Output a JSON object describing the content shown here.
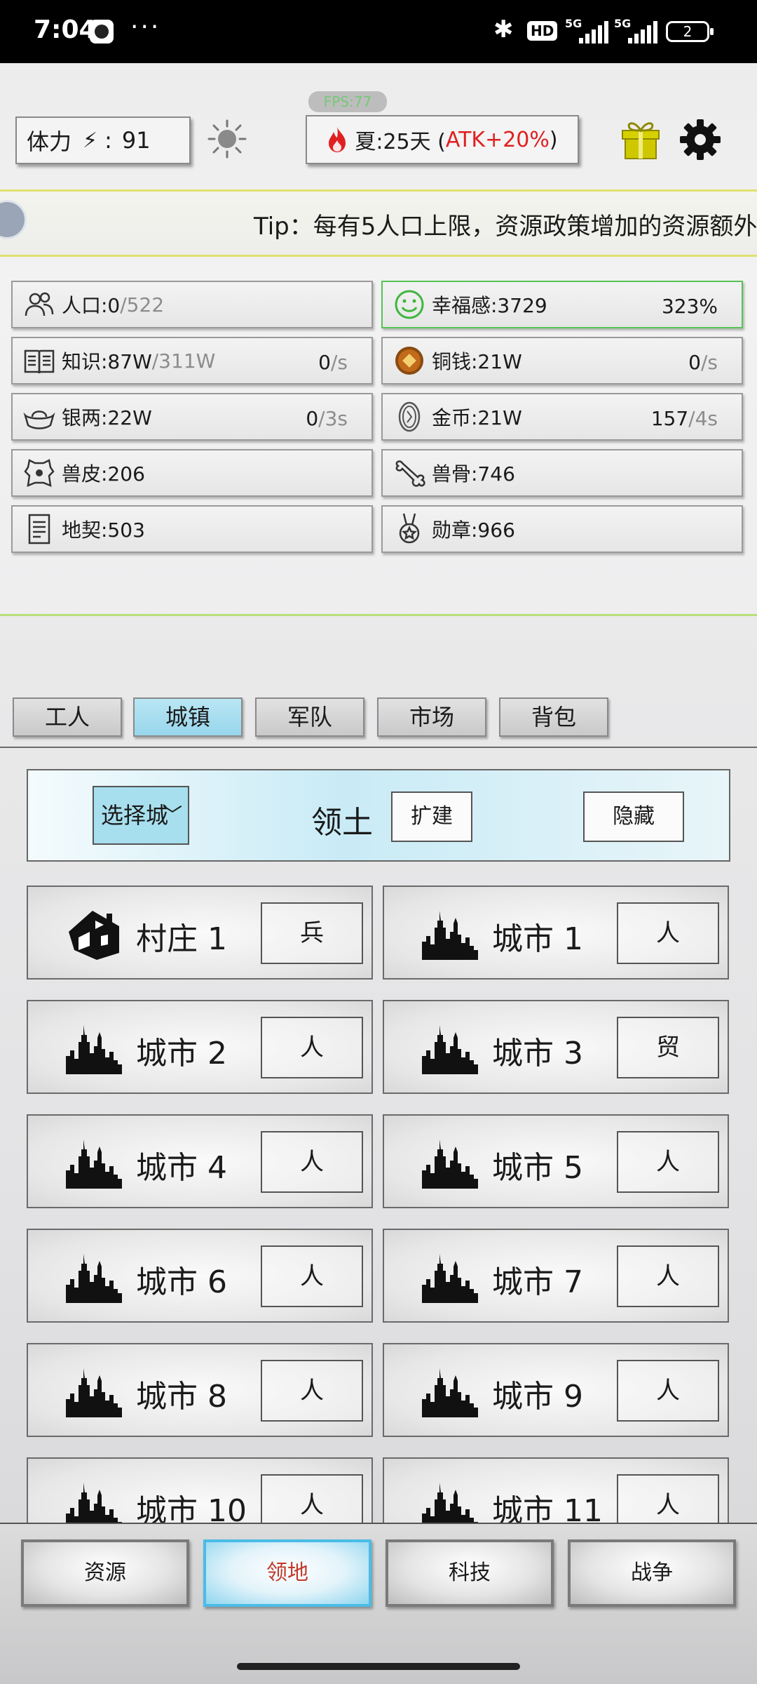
{
  "status_bar": {
    "time": "7:04",
    "dots": "···",
    "hd_badge": "HD",
    "signal1": "5G",
    "signal2": "5G",
    "battery": "2"
  },
  "hud": {
    "fps": "FPS:77",
    "stamina_label": "体力",
    "stamina_sep": ":",
    "stamina_value": "91",
    "season_text": "夏:25天 (",
    "season_bonus": "ATK+20%",
    "season_close": ")",
    "tip": "Tip：每有5人口上限，资源政策增加的资源额外"
  },
  "resources": [
    {
      "name": "人口:0",
      "max": "/522",
      "rate": "",
      "rate_unit": "",
      "icon": "people-icon"
    },
    {
      "name": "幸福感:3729",
      "max": "",
      "rate": "323%",
      "rate_unit": "",
      "icon": "smile-icon"
    },
    {
      "name": "知识:87W",
      "max": "/311W",
      "rate": "0",
      "rate_unit": "/s",
      "icon": "book-icon"
    },
    {
      "name": "铜钱:21W",
      "max": "",
      "rate": "0",
      "rate_unit": "/s",
      "icon": "copper-coin-icon"
    },
    {
      "name": "银两:22W",
      "max": "",
      "rate": "0",
      "rate_unit": "/3s",
      "icon": "silver-ingot-icon"
    },
    {
      "name": "金币:21W",
      "max": "",
      "rate": "157",
      "rate_unit": "/4s",
      "icon": "gold-coin-icon"
    },
    {
      "name": "兽皮:206",
      "max": "",
      "rate": "",
      "rate_unit": "",
      "icon": "hide-icon"
    },
    {
      "name": "兽骨:746",
      "max": "",
      "rate": "",
      "rate_unit": "",
      "icon": "bone-icon"
    },
    {
      "name": "地契:503",
      "max": "",
      "rate": "",
      "rate_unit": "",
      "icon": "deed-icon"
    },
    {
      "name": "勋章:966",
      "max": "",
      "rate": "",
      "rate_unit": "",
      "icon": "medal-icon"
    }
  ],
  "tabs": [
    {
      "label": "工人",
      "active": false
    },
    {
      "label": "城镇",
      "active": true
    },
    {
      "label": "军队",
      "active": false
    },
    {
      "label": "市场",
      "active": false
    },
    {
      "label": "背包",
      "active": false
    }
  ],
  "territory": {
    "select_label": "选择城",
    "title": "领土",
    "expand": "扩建",
    "hide": "隐藏"
  },
  "cities": [
    {
      "name": "村庄 1",
      "action": "兵",
      "icon": "village-house-icon"
    },
    {
      "name": "城市 1",
      "action": "人",
      "icon": "city-skyline-icon"
    },
    {
      "name": "城市 2",
      "action": "人",
      "icon": "city-skyline-icon"
    },
    {
      "name": "城市 3",
      "action": "贸",
      "icon": "city-skyline-icon"
    },
    {
      "name": "城市 4",
      "action": "人",
      "icon": "city-skyline-icon"
    },
    {
      "name": "城市 5",
      "action": "人",
      "icon": "city-skyline-icon"
    },
    {
      "name": "城市 6",
      "action": "人",
      "icon": "city-skyline-icon"
    },
    {
      "name": "城市 7",
      "action": "人",
      "icon": "city-skyline-icon"
    },
    {
      "name": "城市 8",
      "action": "人",
      "icon": "city-skyline-icon"
    },
    {
      "name": "城市 9",
      "action": "人",
      "icon": "city-skyline-icon"
    },
    {
      "name": "城市 10",
      "action": "人",
      "icon": "city-skyline-icon"
    },
    {
      "name": "城市 11",
      "action": "人",
      "icon": "city-skyline-icon"
    }
  ],
  "bottom_nav": [
    {
      "label": "资源",
      "active": false
    },
    {
      "label": "领地",
      "active": true
    },
    {
      "label": "科技",
      "active": false
    },
    {
      "label": "战争",
      "active": false
    }
  ],
  "colors": {
    "accent_blue": "#4bbce6",
    "alert_red": "#e02020",
    "happy_green": "#56c356",
    "gift_yellow": "#d6d000"
  }
}
